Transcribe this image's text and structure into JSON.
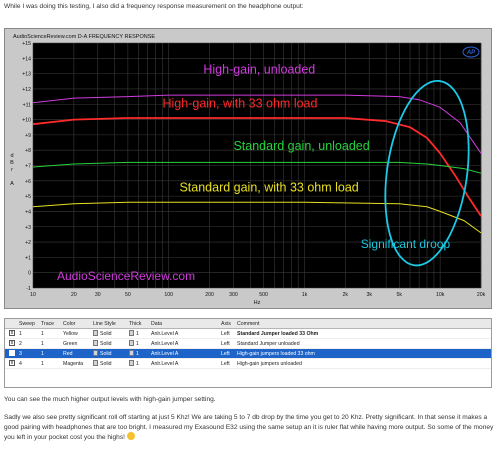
{
  "intro_text": "While I was doing this testing, I also did a frequency response measurement on the headphone output:",
  "plot": {
    "header_left": "AudioScienceReview.com  D-A FREQUENCY RESPONSE",
    "ap_logo": "AP",
    "watermark": "AudioScienceReview.com",
    "ylabel_chars": [
      "d",
      "B",
      "r",
      "",
      "A"
    ],
    "xlabel": "Hz",
    "colors": {
      "background": "#000000",
      "grid": "#3a3a3a",
      "ellipse": "#1cc9e6",
      "tick_text": "#111111"
    },
    "annotations": [
      {
        "text": "High-gain, unloaded",
        "color": "#d23be0"
      },
      {
        "text": "High-gain, with 33 ohm load",
        "color": "#ff2a2a"
      },
      {
        "text": "Standard gain, unloaded",
        "color": "#28d23c"
      },
      {
        "text": "Standard gain, with 33 ohm load",
        "color": "#e8e020"
      },
      {
        "text": "Significant droop",
        "color": "#19c8e0"
      }
    ]
  },
  "chart_data": {
    "type": "line",
    "title": "D-A FREQUENCY RESPONSE",
    "xlabel": "Hz",
    "ylabel": "dBr A",
    "x_scale": "log",
    "xlim": [
      10,
      20000
    ],
    "ylim": [
      -1,
      15
    ],
    "grid": true,
    "x_ticks": [
      {
        "value": 10,
        "label": "10"
      },
      {
        "value": 20,
        "label": "20"
      },
      {
        "value": 30,
        "label": "30"
      },
      {
        "value": 50,
        "label": "50"
      },
      {
        "value": 100,
        "label": "100"
      },
      {
        "value": 200,
        "label": "200"
      },
      {
        "value": 300,
        "label": "300"
      },
      {
        "value": 500,
        "label": "500"
      },
      {
        "value": 1000,
        "label": "1k"
      },
      {
        "value": 2000,
        "label": "2k"
      },
      {
        "value": 3000,
        "label": "3k"
      },
      {
        "value": 5000,
        "label": "5k"
      },
      {
        "value": 10000,
        "label": "10k"
      },
      {
        "value": 20000,
        "label": "20k"
      }
    ],
    "y_ticks": [
      {
        "value": 15,
        "label": "+15"
      },
      {
        "value": 14,
        "label": "+14"
      },
      {
        "value": 13,
        "label": "+13"
      },
      {
        "value": 12,
        "label": "+12"
      },
      {
        "value": 11,
        "label": "+11"
      },
      {
        "value": 10,
        "label": "+10"
      },
      {
        "value": 9,
        "label": "+9"
      },
      {
        "value": 8,
        "label": "+8"
      },
      {
        "value": 7,
        "label": "+7"
      },
      {
        "value": 6,
        "label": "+6"
      },
      {
        "value": 5,
        "label": "+5"
      },
      {
        "value": 4,
        "label": "+4"
      },
      {
        "value": 3,
        "label": "+3"
      },
      {
        "value": 2,
        "label": "+2"
      },
      {
        "value": 1,
        "label": "+1"
      },
      {
        "value": 0,
        "label": "0"
      },
      {
        "value": -1,
        "label": "-1"
      }
    ],
    "series": [
      {
        "color": "#d23be0",
        "x": [
          10,
          20,
          50,
          100,
          500,
          1000,
          2000,
          5000,
          7000,
          10000,
          14000,
          20000
        ],
        "y": [
          11.1,
          11.4,
          11.5,
          11.6,
          11.6,
          11.6,
          11.6,
          11.5,
          11.3,
          10.8,
          9.8,
          7.8
        ]
      },
      {
        "color": "#ff2a2a",
        "x": [
          10,
          20,
          50,
          100,
          500,
          1000,
          2000,
          4000,
          6000,
          8000,
          10000,
          13000,
          16000,
          20000
        ],
        "y": [
          9.7,
          10.0,
          10.1,
          10.1,
          10.1,
          10.1,
          10.1,
          9.9,
          9.5,
          8.8,
          7.8,
          6.3,
          5.0,
          3.7
        ]
      },
      {
        "color": "#28d23c",
        "x": [
          10,
          20,
          50,
          100,
          500,
          1000,
          5000,
          8000,
          10000,
          15000,
          20000
        ],
        "y": [
          6.9,
          7.1,
          7.2,
          7.2,
          7.2,
          7.2,
          7.2,
          7.1,
          7.0,
          6.8,
          6.5
        ]
      },
      {
        "color": "#e8e020",
        "x": [
          10,
          20,
          50,
          100,
          500,
          1000,
          5000,
          8000,
          10000,
          15000,
          20000
        ],
        "y": [
          4.3,
          4.5,
          4.6,
          4.6,
          4.6,
          4.6,
          4.5,
          4.3,
          4.0,
          3.4,
          2.6
        ]
      }
    ]
  },
  "legend_table": {
    "headers": [
      "Sweep",
      "Trace",
      "Color",
      "Line Style",
      "Thick",
      "Data",
      "Axis",
      "Comment"
    ],
    "rows": [
      {
        "checked": "x",
        "sweep": "1",
        "trace": "1",
        "color": "Yellow",
        "style": "Solid",
        "thick": "1",
        "data": "Anlr.Level A",
        "axis": "Left",
        "comment": "Standard Jumper loaded 33 Ohm",
        "selected": false
      },
      {
        "checked": "x",
        "sweep": "2",
        "trace": "1",
        "color": "Green",
        "style": "Solid",
        "thick": "1",
        "data": "Anlr.Level A",
        "axis": "Left",
        "comment": "Standard Jumper unloaded",
        "selected": false
      },
      {
        "checked": "",
        "sweep": "3",
        "trace": "1",
        "color": "Red",
        "style": "Solid",
        "thick": "1",
        "data": "Anlr.Level A",
        "axis": "Left",
        "comment": "High-gain jumpers loaded 33 ohm",
        "selected": true
      },
      {
        "checked": "x",
        "sweep": "4",
        "trace": "1",
        "color": "Magenta",
        "style": "Solid",
        "thick": "1",
        "data": "Anlr.Level A",
        "axis": "Left",
        "comment": "High-gain jumpers unloaded",
        "selected": false
      }
    ]
  },
  "paragraph_1": "You can see the much higher output levels with high-gain jumper setting.",
  "paragraph_2": "Sadly we also see pretty significant roll off starting at just 5 Khz! We are taking 5 to 7 db drop by the time you get to 20 Khz. Pretty significant. In that sense it makes a good pairing with headphones that are too bright. I measured my Exasound E32 using the same setup an it is ruler flat while having more output. So some of the money you left in your pocket cost you the highs!"
}
